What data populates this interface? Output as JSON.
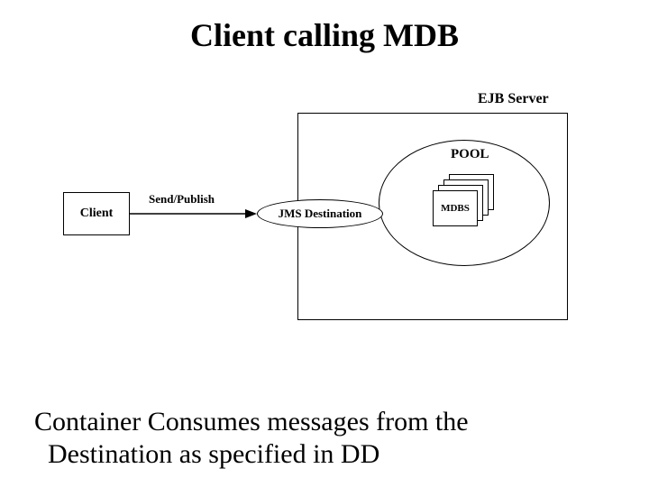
{
  "title": "Client calling MDB",
  "diagram": {
    "ejb_server_label": "EJB Server",
    "pool_label": "POOL",
    "mdb_label": "MDBS",
    "jms_label": "JMS Destination",
    "client_label": "Client",
    "arrow_label": "Send/Publish"
  },
  "caption_line1": "Container Consumes messages from the",
  "caption_line2": "Destination as specified in DD"
}
